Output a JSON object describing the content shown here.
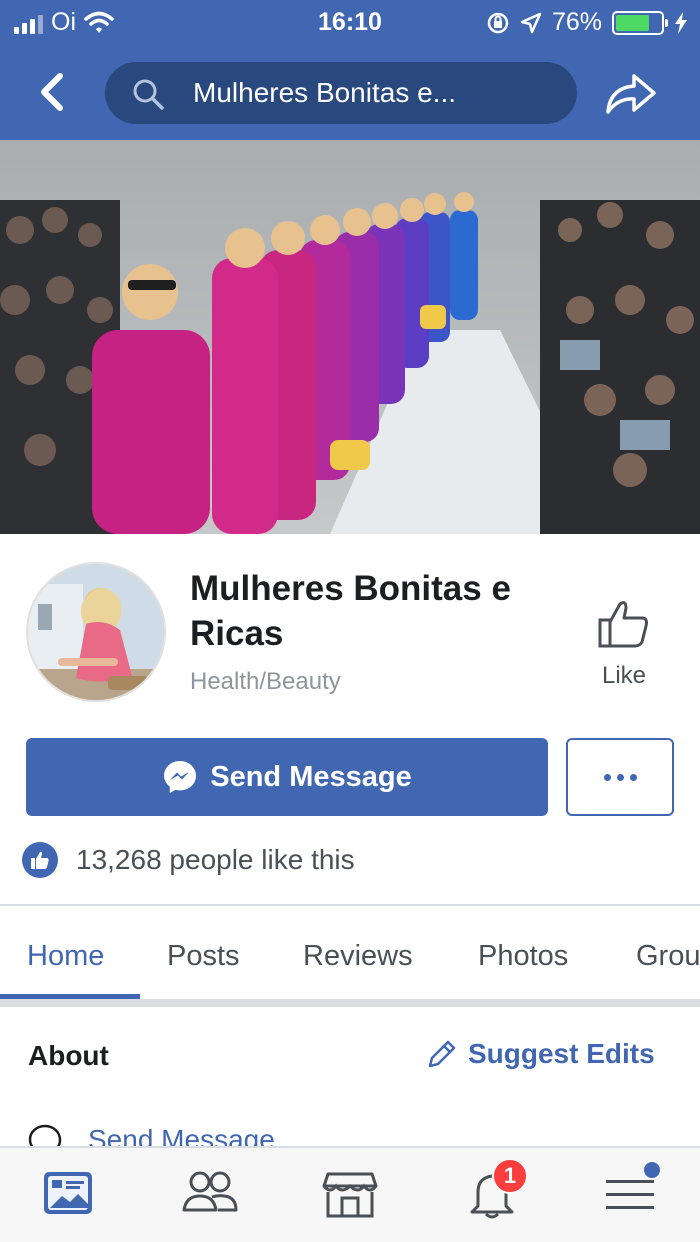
{
  "status_bar": {
    "carrier": "Oi",
    "time": "16:10",
    "battery": "76%",
    "battery_level": 0.76
  },
  "nav": {
    "search_text": "Mulheres Bonitas e..."
  },
  "page": {
    "name": "Mulheres Bonitas e Ricas",
    "category": "Health/Beauty",
    "like_label": "Like",
    "send_message_label": "Send Message",
    "likes_text": "13,268 people like this"
  },
  "tabs": [
    {
      "label": "Home"
    },
    {
      "label": "Posts"
    },
    {
      "label": "Reviews"
    },
    {
      "label": "Photos"
    },
    {
      "label": "Grou"
    }
  ],
  "about": {
    "title": "About",
    "suggest_edits": "Suggest Edits",
    "send_message_row": "Send Message"
  },
  "bottom_nav": {
    "notifications_badge": "1"
  },
  "colors": {
    "brand_blue": "#4267b2",
    "search_bg": "#29487d",
    "badge_red": "#fa3e3e"
  }
}
